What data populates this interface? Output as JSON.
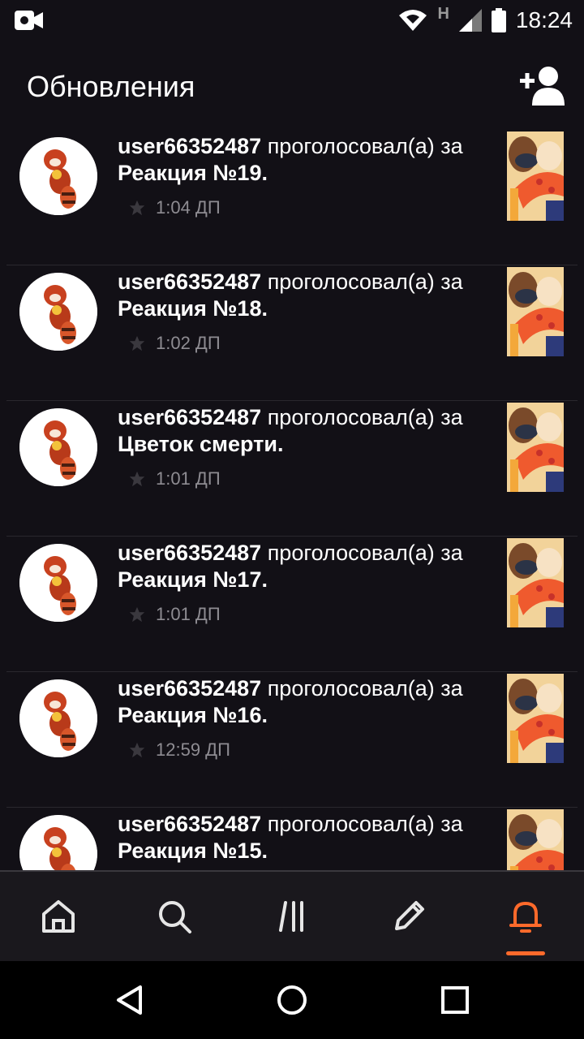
{
  "status_bar": {
    "time": "18:24",
    "network_letter": "H"
  },
  "app_bar": {
    "title": "Обновления"
  },
  "feed": {
    "items": [
      {
        "user": "user66352487",
        "action": "проголосовал(а) за",
        "target": "Реакция №19.",
        "time": "1:04 ДП"
      },
      {
        "user": "user66352487",
        "action": "проголосовал(а) за",
        "target": "Реакция №18.",
        "time": "1:02 ДП"
      },
      {
        "user": "user66352487",
        "action": "проголосовал(а) за",
        "target": "Цветок смерти.",
        "time": "1:01 ДП"
      },
      {
        "user": "user66352487",
        "action": "проголосовал(а) за",
        "target": "Реакция №17.",
        "time": "1:01 ДП"
      },
      {
        "user": "user66352487",
        "action": "проголосовал(а) за",
        "target": "Реакция №16.",
        "time": "12:59 ДП"
      },
      {
        "user": "user66352487",
        "action": "проголосовал(а) за",
        "target": "Реакция №15.",
        "time": ""
      }
    ]
  },
  "bottom_nav": {
    "items": [
      "home-icon",
      "search-icon",
      "library-icon",
      "write-icon",
      "notifications-icon"
    ],
    "active": "notifications-icon",
    "accent_color": "#ff6a2b"
  },
  "system_nav": {
    "items": [
      "back-icon",
      "home-circle-icon",
      "recents-icon"
    ]
  }
}
